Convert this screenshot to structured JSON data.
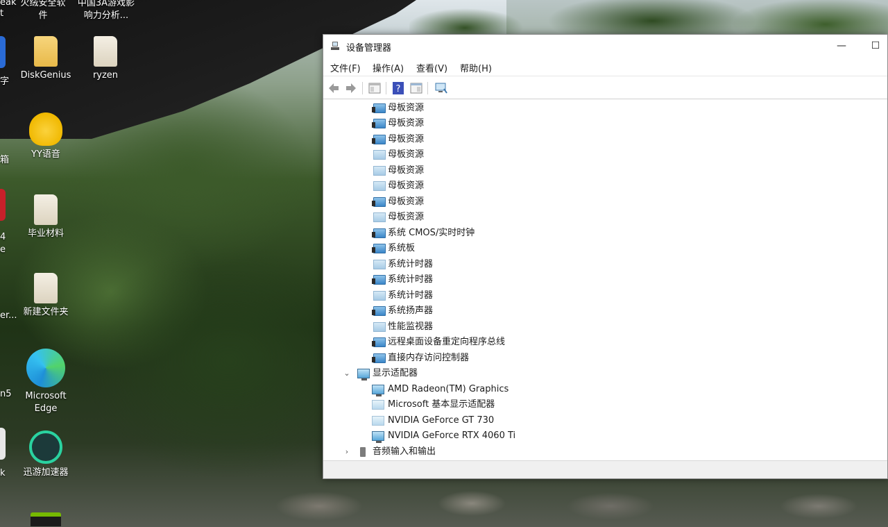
{
  "desktop": {
    "icons": [
      {
        "label": "火绒安全软件",
        "glyph": "huorong-icon"
      },
      {
        "label": "中国3A游戏影响力分析...",
        "glyph": "folder-icon"
      },
      {
        "label": "DiskGenius",
        "glyph": "diskgenius-icon"
      },
      {
        "label": "ryzen",
        "glyph": "folder-icon"
      },
      {
        "label": "YY语音",
        "glyph": "yy-icon"
      },
      {
        "label": "毕业材料",
        "glyph": "folder-icon"
      },
      {
        "label": "新建文件夹",
        "glyph": "folder-icon"
      },
      {
        "label": "Microsoft Edge",
        "glyph": "edge-icon"
      },
      {
        "label": "迅游加速器",
        "glyph": "xunyou-icon"
      }
    ],
    "cut_labels": [
      "eak",
      "t",
      "字",
      "箱",
      "4",
      "e",
      "er...",
      "n5",
      "k"
    ]
  },
  "window": {
    "title": "设备管理器",
    "min_symbol": "—",
    "max_symbol": "☐",
    "menu": [
      "文件(F)",
      "操作(A)",
      "查看(V)",
      "帮助(H)"
    ],
    "toolbar": [
      "back-icon",
      "forward-icon",
      "properties-icon",
      "help-icon",
      "console-icon",
      "scan-icon"
    ]
  },
  "tree": {
    "system_devices": [
      {
        "label": "母板资源",
        "icon": "system-device-icon"
      },
      {
        "label": "母板资源",
        "icon": "system-device-icon"
      },
      {
        "label": "母板资源",
        "icon": "system-device-icon"
      },
      {
        "label": "母板资源",
        "icon": "system-device-light-icon"
      },
      {
        "label": "母板资源",
        "icon": "system-device-light-icon"
      },
      {
        "label": "母板资源",
        "icon": "system-device-light-icon"
      },
      {
        "label": "母板资源",
        "icon": "system-device-icon"
      },
      {
        "label": "母板资源",
        "icon": "system-device-light-icon"
      },
      {
        "label": "系统 CMOS/实时时钟",
        "icon": "system-device-icon"
      },
      {
        "label": "系统板",
        "icon": "system-device-icon"
      },
      {
        "label": "系统计时器",
        "icon": "system-device-light-icon"
      },
      {
        "label": "系统计时器",
        "icon": "system-device-icon"
      },
      {
        "label": "系统计时器",
        "icon": "system-device-light-icon"
      },
      {
        "label": "系统扬声器",
        "icon": "system-device-icon"
      },
      {
        "label": "性能监视器",
        "icon": "system-device-light-icon"
      },
      {
        "label": "远程桌面设备重定向程序总线",
        "icon": "system-device-icon"
      },
      {
        "label": "直接内存访问控制器",
        "icon": "system-device-icon"
      }
    ],
    "display_category": {
      "label": "显示适配器",
      "expanded": true,
      "chevron": "⌄"
    },
    "display_adapters": [
      {
        "label": "AMD Radeon(TM) Graphics",
        "icon": "display-adapter-icon"
      },
      {
        "label": "Microsoft 基本显示适配器",
        "icon": "display-adapter-light-icon"
      },
      {
        "label": "NVIDIA GeForce GT 730",
        "icon": "display-adapter-light-icon"
      },
      {
        "label": "NVIDIA GeForce RTX 4060 Ti",
        "icon": "display-adapter-icon"
      }
    ],
    "audio_category": {
      "label": "音频输入和输出",
      "expanded": false,
      "chevron": "›"
    }
  }
}
